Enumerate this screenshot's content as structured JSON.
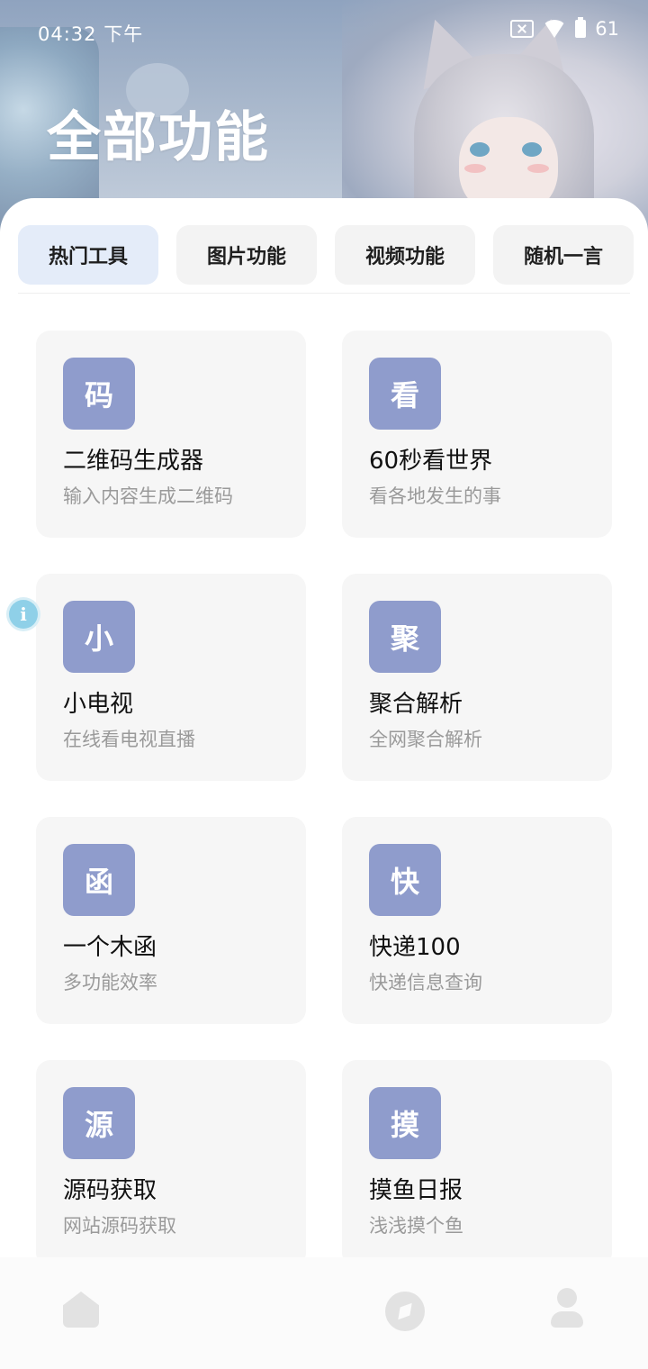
{
  "status": {
    "time": "04:32 下午",
    "battery": "61"
  },
  "header": {
    "title": "全部功能"
  },
  "tabs": [
    {
      "label": "热门工具",
      "active": true
    },
    {
      "label": "图片功能",
      "active": false
    },
    {
      "label": "视频功能",
      "active": false
    },
    {
      "label": "随机一言",
      "active": false
    }
  ],
  "cards": [
    {
      "icon_char": "码",
      "title": "二维码生成器",
      "subtitle": "输入内容生成二维码"
    },
    {
      "icon_char": "看",
      "title": "60秒看世界",
      "subtitle": "看各地发生的事"
    },
    {
      "icon_char": "小",
      "title": "小电视",
      "subtitle": "在线看电视直播"
    },
    {
      "icon_char": "聚",
      "title": "聚合解析",
      "subtitle": "全网聚合解析"
    },
    {
      "icon_char": "函",
      "title": "一个木函",
      "subtitle": "多功能效率"
    },
    {
      "icon_char": "快",
      "title": "快递100",
      "subtitle": "快递信息查询"
    },
    {
      "icon_char": "源",
      "title": "源码获取",
      "subtitle": "网站源码获取"
    },
    {
      "icon_char": "摸",
      "title": "摸鱼日报",
      "subtitle": "浅浅摸个鱼"
    }
  ],
  "floating": {
    "info_icon": "i"
  },
  "bottom_nav": [
    {
      "icon": "home-icon"
    },
    {
      "icon": "compass-icon"
    },
    {
      "icon": "user-icon"
    }
  ],
  "colors": {
    "accent_tab_bg": "#e4ecf9",
    "card_icon_bg": "#8f9ccc",
    "card_bg": "#f6f6f6"
  }
}
